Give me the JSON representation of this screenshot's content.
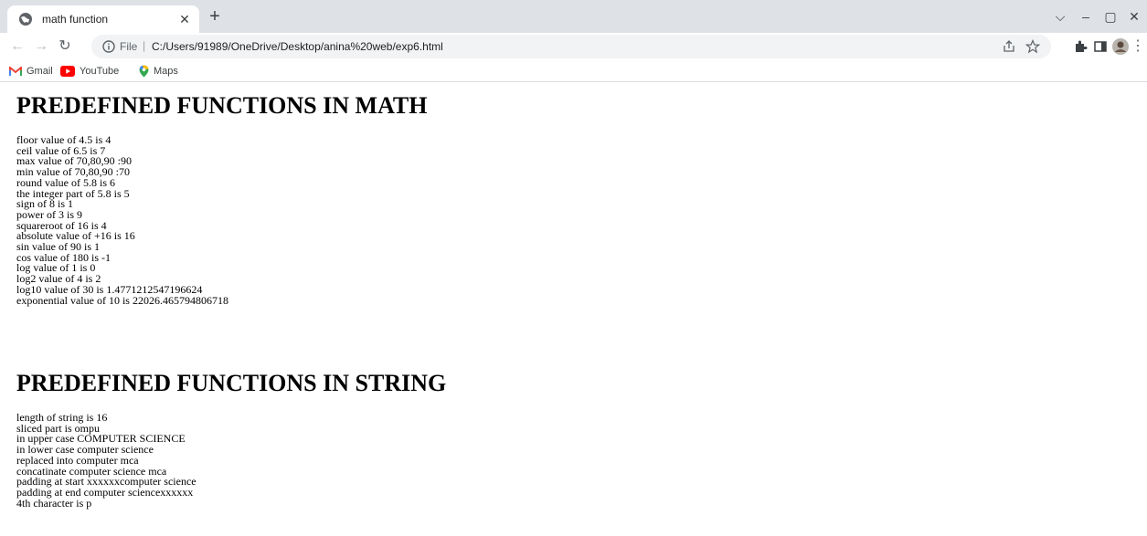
{
  "browser": {
    "tab": {
      "title": "math function"
    },
    "address": {
      "scheme": "File",
      "url": "C:/Users/91989/OneDrive/Desktop/anina%20web/exp6.html"
    },
    "bookmarks": [
      "Gmail",
      "YouTube",
      "Maps"
    ],
    "colors": {
      "tabstrip": "#dee1e6",
      "gmail_red": "#ea4335",
      "youtube_red": "#ff0000",
      "maps_green": "#34a853"
    }
  },
  "page": {
    "math_heading": "PREDEFINED FUNCTIONS IN MATH",
    "math_lines": [
      "floor value of 4.5 is 4",
      "ceil value of 6.5 is 7",
      "max value of 70,80,90 :90",
      "min value of 70,80,90 :70",
      "round value of 5.8 is 6",
      "the integer part of 5.8 is 5",
      "sign of 8 is 1",
      "power of 3 is 9",
      "squareroot of 16 is 4",
      "absolute value of +16 is 16",
      "sin value of 90 is 1",
      "cos value of 180 is -1",
      "log value of 1 is 0",
      "log2 value of 4 is 2",
      "log10 value of 30 is 1.4771212547196624",
      "exponential value of 10 is 22026.465794806718"
    ],
    "string_heading": "PREDEFINED FUNCTIONS IN STRING",
    "string_lines": [
      "length of string is 16",
      "sliced part is ompu",
      "in upper case COMPUTER SCIENCE",
      "in lower case computer science",
      "replaced into computer mca",
      "concatinate computer science mca",
      "padding at start xxxxxxcomputer science",
      "padding at end computer sciencexxxxxx",
      "4th character is p"
    ]
  }
}
